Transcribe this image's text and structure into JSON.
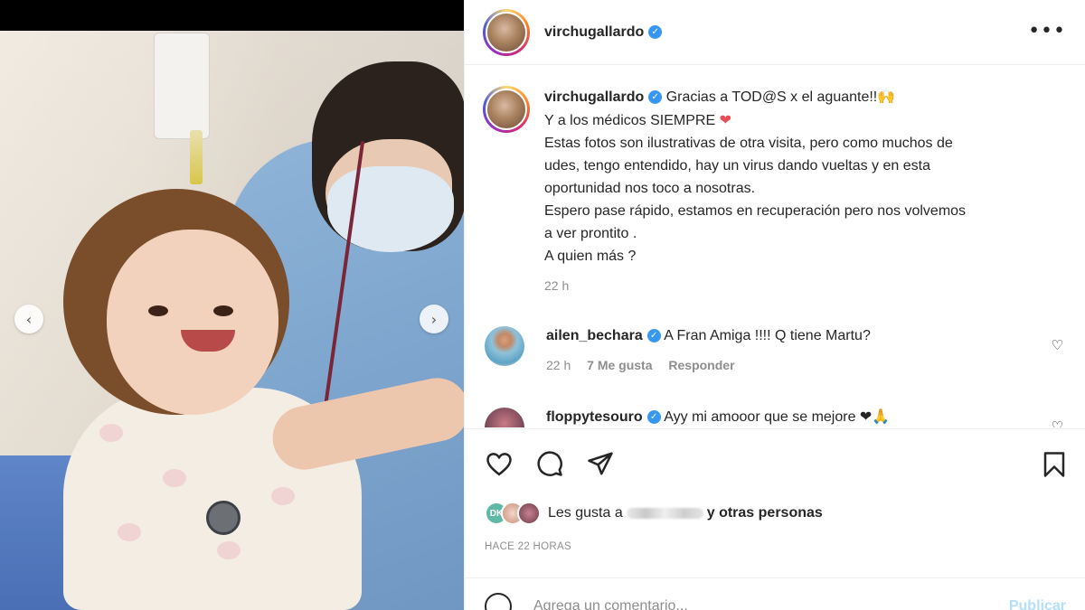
{
  "post": {
    "username": "virchugallardo",
    "more_icon": "more-options-icon"
  },
  "caption": {
    "username": "virchugallardo",
    "line1": "Gracias a TOD@S x el aguante!!🙌",
    "line2_text": "Y a los médicos SIEMPRE ",
    "line2_emoji": "❤",
    "body": [
      "Estas fotos son ilustrativas de otra visita, pero como muchos de",
      "udes, tengo entendido, hay un virus dando vueltas y en esta",
      "oportunidad nos toco a nosotras.",
      "Espero pase rápido, estamos en recuperación pero nos volvemos",
      "a ver prontito .",
      "A quien más ?"
    ],
    "time": "22 h"
  },
  "comments": [
    {
      "username": "ailen_bechara",
      "text": "A Fran Amiga !!!! Q tiene Martu?",
      "time": "22 h",
      "likes": "7 Me gusta",
      "reply": "Responder"
    },
    {
      "username": "floppytesouro",
      "text": "Ayy mi amooor que se mejore ❤🙏"
    }
  ],
  "likes": {
    "prefix": "Les gusta a",
    "suffix": "y otras personas",
    "avatar_initials": "DK"
  },
  "timestamp": "HACE 22 HORAS",
  "add_comment": {
    "placeholder": "Agrega un comentario...",
    "publish": "Publicar"
  },
  "colors": {
    "verified": "#3897f0",
    "heart": "#ed4956",
    "publish_disabled": "#b2dffc"
  }
}
